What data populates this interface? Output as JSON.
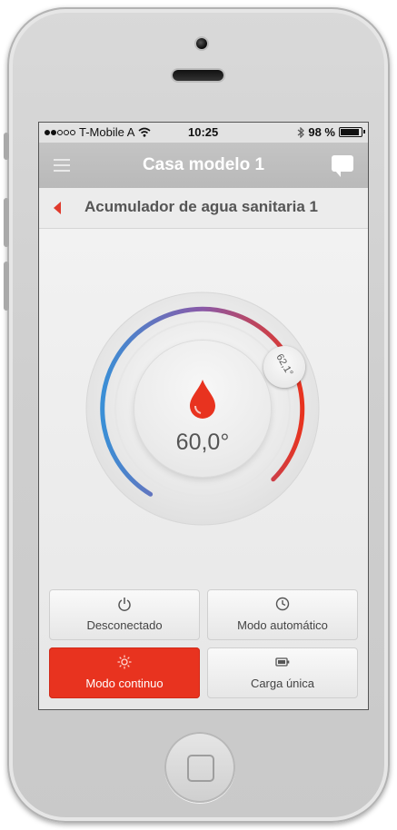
{
  "status_bar": {
    "carrier": "T-Mobile A",
    "time": "10:25",
    "battery_percent": "98 %"
  },
  "nav": {
    "title": "Casa modelo 1",
    "menu_icon": "menu-icon",
    "chat_icon": "chat-icon"
  },
  "sub_header": {
    "title": "Acumulador de agua sanitaria 1",
    "back_icon": "back-arrow-icon"
  },
  "dial": {
    "current_temp": "60,0°",
    "setpoint": "62,1°",
    "cold_color": "#3a8fd6",
    "hot_color": "#e8331f"
  },
  "modes": [
    {
      "label": "Desconectado",
      "icon": "power-icon",
      "active": false
    },
    {
      "label": "Modo automático",
      "icon": "clock-icon",
      "active": false
    },
    {
      "label": "Modo continuo",
      "icon": "sun-icon",
      "active": true
    },
    {
      "label": "Carga única",
      "icon": "battery-icon",
      "active": false
    }
  ],
  "colors": {
    "accent": "#e8331f",
    "navbar": "#bcbcbc"
  }
}
